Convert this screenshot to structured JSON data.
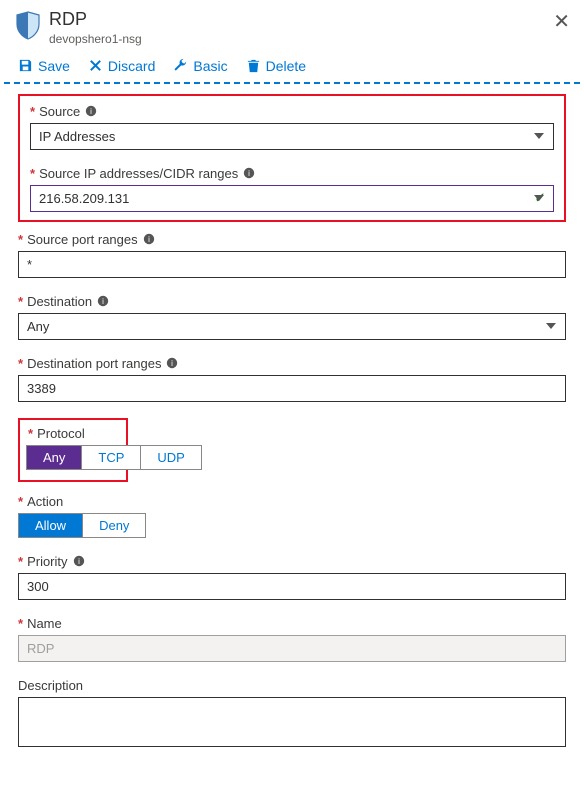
{
  "header": {
    "title": "RDP",
    "subtitle": "devopshero1-nsg"
  },
  "toolbar": {
    "save": "Save",
    "discard": "Discard",
    "basic": "Basic",
    "delete": "Delete"
  },
  "fields": {
    "source": {
      "label": "Source",
      "value": "IP Addresses"
    },
    "sourceIps": {
      "label": "Source IP addresses/CIDR ranges",
      "value": "216.58.209.131"
    },
    "sourcePorts": {
      "label": "Source port ranges",
      "value": "*"
    },
    "destination": {
      "label": "Destination",
      "value": "Any"
    },
    "destPorts": {
      "label": "Destination port ranges",
      "value": "3389"
    },
    "protocol": {
      "label": "Protocol",
      "options": {
        "any": "Any",
        "tcp": "TCP",
        "udp": "UDP"
      }
    },
    "action": {
      "label": "Action",
      "options": {
        "allow": "Allow",
        "deny": "Deny"
      }
    },
    "priority": {
      "label": "Priority",
      "value": "300"
    },
    "name": {
      "label": "Name",
      "value": "RDP"
    },
    "description": {
      "label": "Description",
      "value": ""
    }
  }
}
